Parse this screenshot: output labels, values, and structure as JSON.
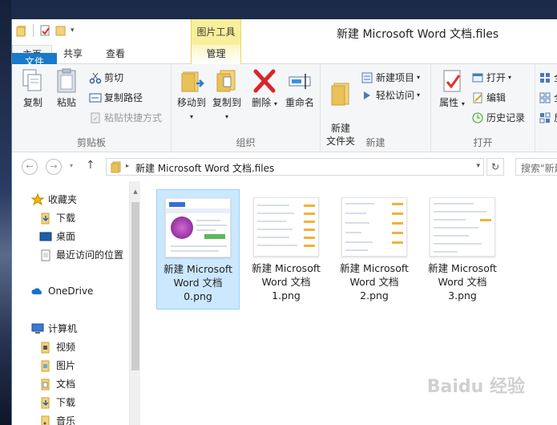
{
  "window": {
    "title": "新建 Microsoft Word 文档.files",
    "context_tab_header": "图片工具"
  },
  "tabs": {
    "file": "文件",
    "home": "主页",
    "share": "共享",
    "view": "查看",
    "manage": "管理"
  },
  "ribbon": {
    "clipboard": {
      "label": "剪贴板",
      "copy": "复制",
      "paste": "粘贴",
      "cut": "剪切",
      "copy_path": "复制路径",
      "paste_shortcut": "粘贴快捷方式"
    },
    "organize": {
      "label": "组织",
      "move_to": "移动到",
      "copy_to": "复制到",
      "delete": "删除",
      "rename": "重命名"
    },
    "new": {
      "label": "新建",
      "new_folder": "新建\n文件夹",
      "new_item": "新建项目",
      "easy_access": "轻松访问"
    },
    "open": {
      "label": "打开",
      "properties": "属性",
      "open": "打开",
      "edit": "编辑",
      "history": "历史记录"
    },
    "select": {
      "all": "全",
      "none": "全",
      "invert": "反"
    }
  },
  "address": {
    "path": "新建 Microsoft Word 文档.files",
    "search_placeholder": "搜索\"新建"
  },
  "nav": {
    "favorites": "收藏夹",
    "downloads": "下载",
    "desktop": "桌面",
    "recent": "最近访问的位置",
    "onedrive": "OneDrive",
    "computer": "计算机",
    "videos": "视频",
    "pictures": "图片",
    "documents": "文档",
    "downloads2": "下载",
    "music": "音乐"
  },
  "files": [
    {
      "name": "新建 Microsoft Word 文档 0.png"
    },
    {
      "name": "新建 Microsoft Word 文档 1.png"
    },
    {
      "name": "新建 Microsoft Word 文档 2.png"
    },
    {
      "name": "新建 Microsoft Word 文档 3.png"
    }
  ],
  "watermark": "Baidu 经验",
  "colors": {
    "accent": "#1979ca",
    "selection": "#cce8ff",
    "context_tab": "#f8ef9a"
  }
}
